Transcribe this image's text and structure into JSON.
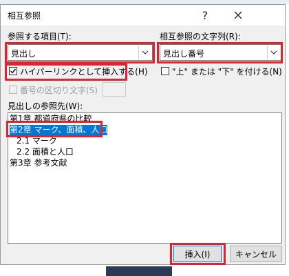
{
  "background": {
    "top_text": "...",
    "accent": "#e0232f"
  },
  "dialog": {
    "title": "相互参照",
    "window_controls": {
      "help": "?",
      "close": "✕"
    }
  },
  "reference_type": {
    "label": "参照する項目(T):",
    "value": "見出し"
  },
  "reference_text": {
    "label": "相互参照の文字列(R):",
    "value": "見出し番号"
  },
  "hyperlink_checkbox": {
    "label": "ハイパーリンクとして挿入する(H)",
    "checked": true
  },
  "above_below_checkbox": {
    "label": "\"上\" または \"下\" を付ける(N)",
    "checked": false
  },
  "separator_checkbox": {
    "label": "番号の区切り文字(S)",
    "checked": false,
    "enabled": false
  },
  "target_list": {
    "label": "見出しの参照先(W):",
    "items": [
      {
        "text": "第1章 都道府県の比較"
      },
      {
        "text": "第2章 マーク、面積、人口"
      },
      {
        "text": "2.1 マーク"
      },
      {
        "text": "2.2 面積と人口"
      },
      {
        "text": "第3章 参考文献"
      }
    ]
  },
  "buttons": {
    "insert": "挿入(I)",
    "cancel": "キャンセル"
  },
  "icons": [
    "checkmark-icon",
    "dropdown-arrow-icon",
    "help-icon",
    "close-icon"
  ]
}
